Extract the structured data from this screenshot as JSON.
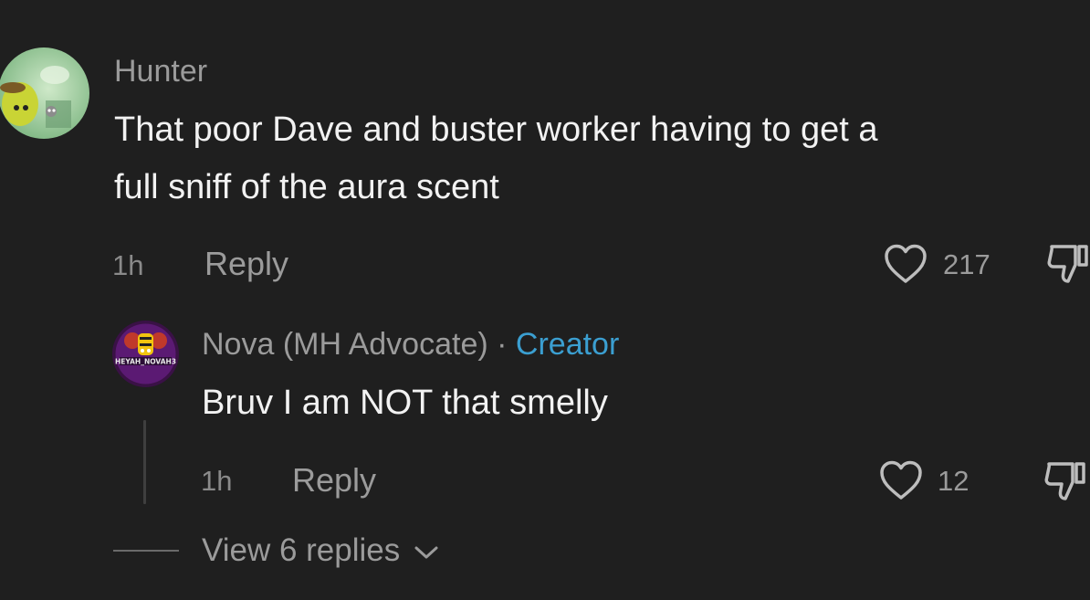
{
  "comment": {
    "username": "Hunter",
    "text_line1": "That poor Dave and buster worker having to get a",
    "text_line2": "full sniff of the aura scent",
    "time": "1h",
    "reply_label": "Reply",
    "like_count": "217",
    "avatar_icon": "cartoon-character-avatar",
    "reply": {
      "username": "Nova (MH Advocate)",
      "separator": "·",
      "badge": "Creator",
      "text": "Bruv I am NOT that smelly",
      "time": "1h",
      "reply_label": "Reply",
      "like_count": "12",
      "avatar_icon": "nova-logo-avatar",
      "avatar_caption": "HEYAH_NOVAH3"
    },
    "view_replies_label": "View 6 replies"
  },
  "colors": {
    "background": "#1f1f1f",
    "creator_accent": "#3b9fd1",
    "muted_text": "#9b9b9b",
    "primary_text": "#f2f2f2"
  }
}
